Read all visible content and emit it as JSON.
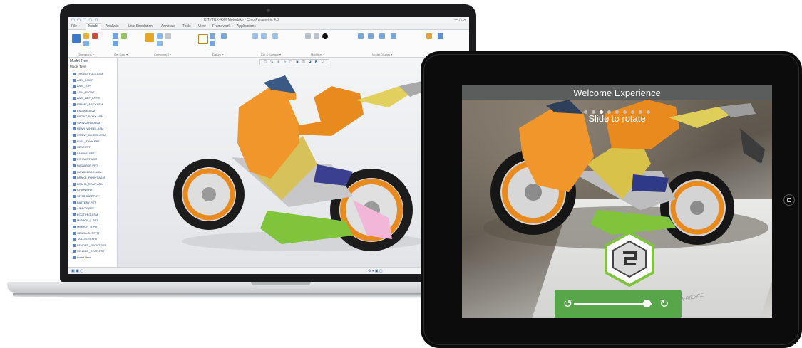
{
  "laptop": {
    "window_title": "KIT (TRX-450) Motorbike - Creo Parametric 4.0",
    "qat_icons": "▢ ▢ ▢ ▢ ▢",
    "window_controls": "— ▢ ✕",
    "tabs": [
      "File",
      "Model",
      "Analysis",
      "Live Simulation",
      "Annotate",
      "Tools",
      "View",
      "Framework",
      "Applications"
    ],
    "active_tab": "Model",
    "ribbon_groups": [
      "Operations ▾",
      "Get Data ▾",
      "Component ▾",
      "Datum ▾",
      "Cut & Surface ▾",
      "Modifiers ▾",
      "Model Display ▾",
      "Model Intent ▾"
    ],
    "sidebar": {
      "title": "Model Tree",
      "subtitle": "Model Tree",
      "rows": [
        "TRX450_FULL.ASM",
        "ASM_RIGHT",
        "ASM_TOP",
        "ASM_FRONT",
        "ASM_DEF_CSYS",
        "FRAME_ASSY.ASM",
        "ENGINE.ASM",
        "FRONT_FORK.ASM",
        "SWINGARM.ASM",
        "REAR_WHEEL.ASM",
        "FRONT_WHEEL.ASM",
        "FUEL_TANK.PRT",
        "SEAT.PRT",
        "FAIRING.PRT",
        "EXHAUST.ASM",
        "RADIATOR.PRT",
        "HANDLEBAR.ASM",
        "BRAKE_FRONT.ASM",
        "BRAKE_REAR.ASM",
        "CHAIN.PRT",
        "SPROCKET.PRT",
        "BATTERY.PRT",
        "AIRBOX.PRT",
        "FOOTPEG.ASM",
        "MIRROR_L.PRT",
        "MIRROR_R.PRT",
        "HEADLIGHT.PRT",
        "TAILLIGHT.PRT",
        "FENDER_FRONT.PRT",
        "FENDER_REAR.PRT",
        "Insert Here"
      ]
    },
    "view_toolbar": "◱ 🔍 ⊕ ⊖ ▢ ▣ ◫ ◪ ◩ ↻",
    "status_icons": "▣ ▣ ▢",
    "status_right": "⚙ ▾ ▣ ▢"
  },
  "tablet": {
    "title": "Welcome Experience",
    "instruction": "Slide to rotate",
    "dots_total": 9,
    "dots_active_index": 2,
    "slider_left_icon": "↺",
    "slider_right_icon": "↻",
    "slider_position": 0.93,
    "marker_text": "EXPERIENCE"
  },
  "colors": {
    "bike_orange": "#e98a1f",
    "bike_green": "#7fc43a",
    "slider_green": "#58a64a",
    "title_bar": "#5b5c5c"
  }
}
